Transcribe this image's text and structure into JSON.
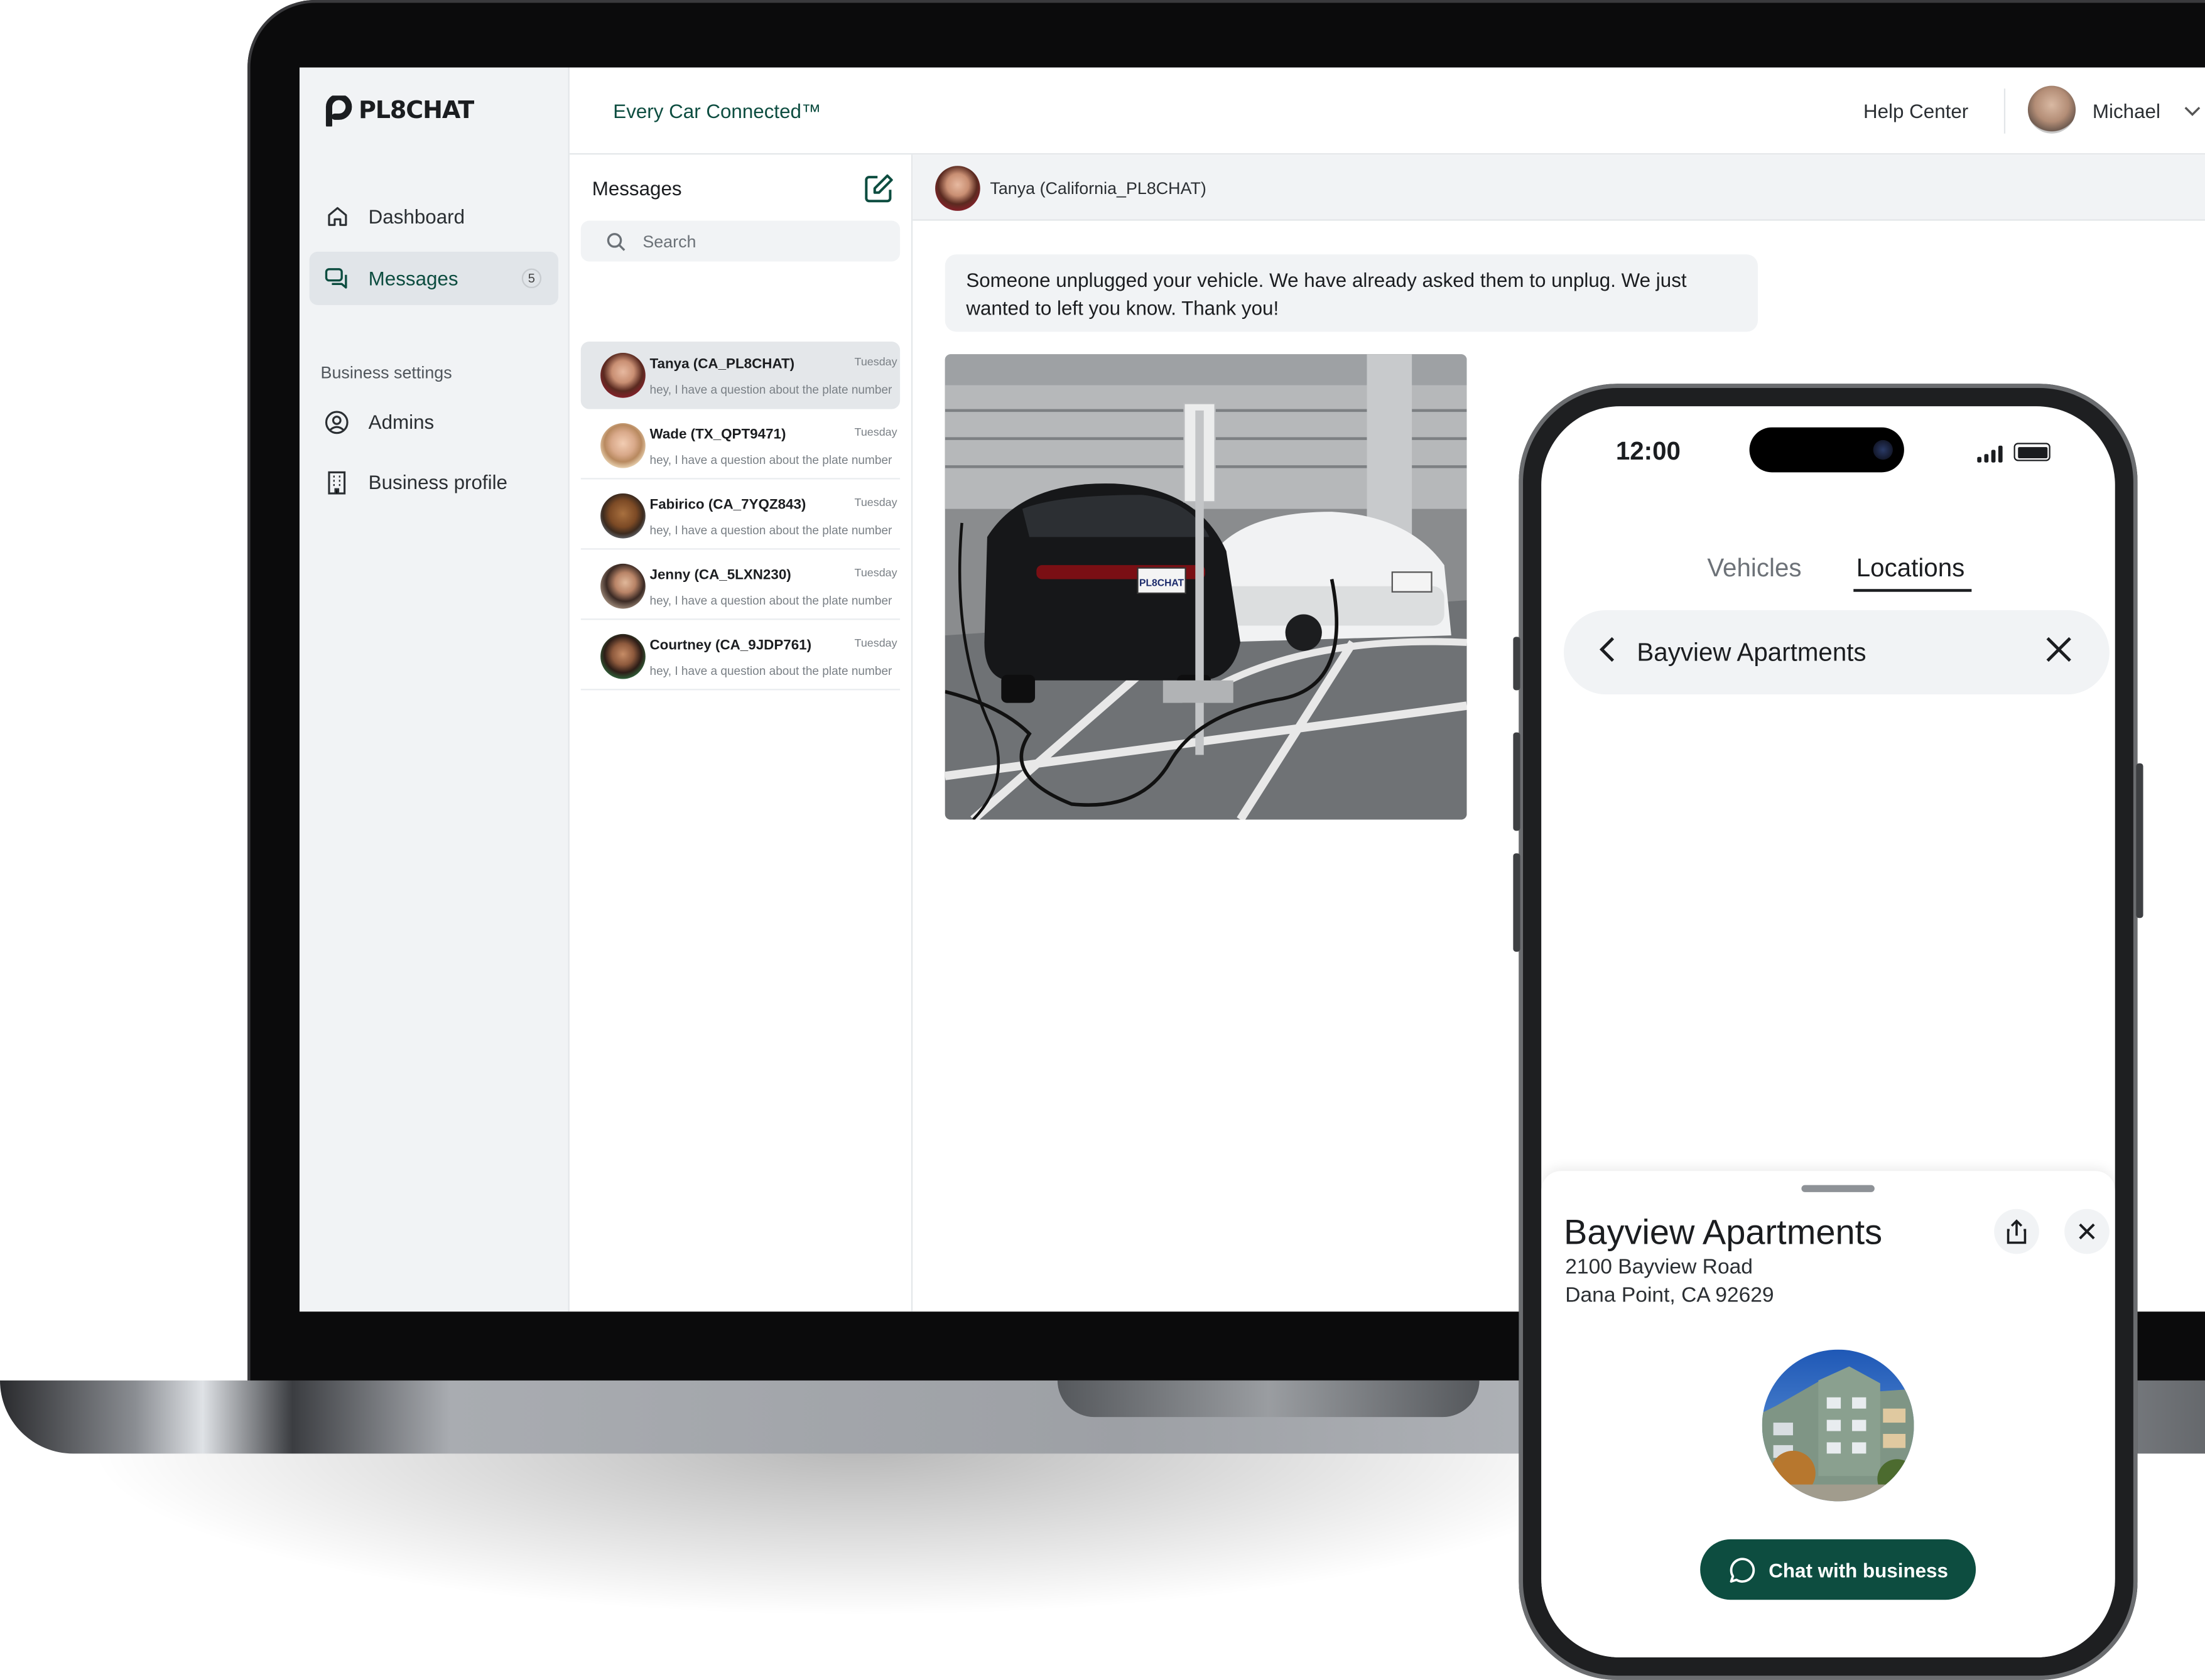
{
  "app": {
    "logo_text": "PL8CHAT",
    "tagline": "Every Car Connected™",
    "help_label": "Help Center",
    "user_name": "Michael"
  },
  "sidebar": {
    "items": [
      {
        "label": "Dashboard",
        "icon": "home-icon"
      },
      {
        "label": "Messages",
        "icon": "chat-icon",
        "badge": "5",
        "active": true
      }
    ],
    "section_label": "Business settings",
    "settings_items": [
      {
        "label": "Admins",
        "icon": "user-circle-icon"
      },
      {
        "label": "Business profile",
        "icon": "building-icon"
      }
    ]
  },
  "messages": {
    "title": "Messages",
    "search_placeholder": "Search",
    "conversations": [
      {
        "name": "Tanya (CA_PL8CHAT)",
        "day": "Tuesday",
        "preview": "hey, I have a question about the plate number",
        "active": true
      },
      {
        "name": "Wade (TX_QPT9471)",
        "day": "Tuesday",
        "preview": "hey, I have a question about the plate number"
      },
      {
        "name": "Fabirico (CA_7YQZ843)",
        "day": "Tuesday",
        "preview": "hey, I have a question about the plate number"
      },
      {
        "name": "Jenny (CA_5LXN230)",
        "day": "Tuesday",
        "preview": "hey, I have a question about the plate number"
      },
      {
        "name": "Courtney (CA_9JDP761)",
        "day": "Tuesday",
        "preview": "hey, I have a question about the plate number"
      }
    ]
  },
  "conversation": {
    "contact": "Tanya (California_PL8CHAT)",
    "message": "Someone unplugged your vehicle. We have already asked them to unplug. We just wanted to left you know. Thank you!",
    "plate_text": "PL8CHAT"
  },
  "phone": {
    "time": "12:00",
    "tabs": [
      "Vehicles",
      "Locations"
    ],
    "active_tab": "Locations",
    "location_pill": "Bayview Apartments",
    "sheet": {
      "title": "Bayview Apartments",
      "address_line1": "2100 Bayview Road",
      "address_line2": "Dana Point, CA 92629",
      "button_label": "Chat with business"
    }
  },
  "colors": {
    "brand": "#0d4d40",
    "sidebar_bg": "#f1f3f5",
    "text": "#1b1d20"
  }
}
